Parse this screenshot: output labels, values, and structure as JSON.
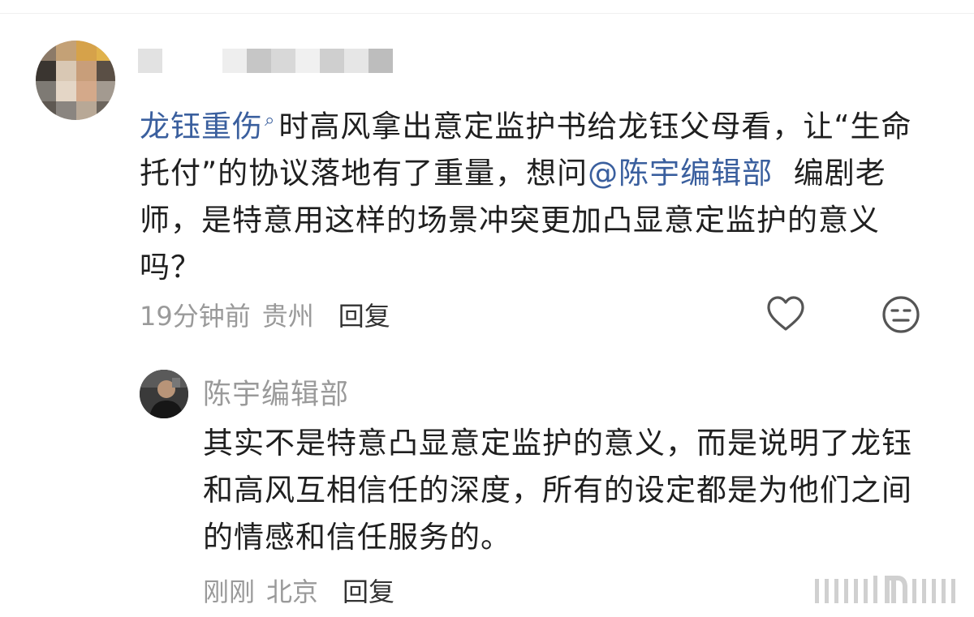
{
  "comment": {
    "link_topic": "龙钰重伤",
    "text_before_mention": "时高风拿出意定监护书给龙钰父母看，让“生命托付”的协议落地有了重量，想问",
    "mention": "@陈宇编辑部",
    "text_after_mention": "编剧老师，是特意用这样的场景冲突更加凸显意定监护的意义吗？",
    "time": "19分钟前",
    "location": "贵州",
    "reply_label": "回复"
  },
  "reply": {
    "author": "陈宇编辑部",
    "text": "其实不是特意凸显意定监护的意义，而是说明了龙钰和高风互相信任的深度，所有的设定都是为他们之间的情感和信任服务的。",
    "time": "刚刚",
    "location": "北京",
    "reply_label": "回复"
  },
  "icons": {
    "like": "heart-outline-icon",
    "dislike": "neutral-face-icon",
    "link_search": "search-icon"
  },
  "colors": {
    "link": "#3a5f9e",
    "text": "#1f1f1f",
    "muted": "#9a9a9a"
  }
}
